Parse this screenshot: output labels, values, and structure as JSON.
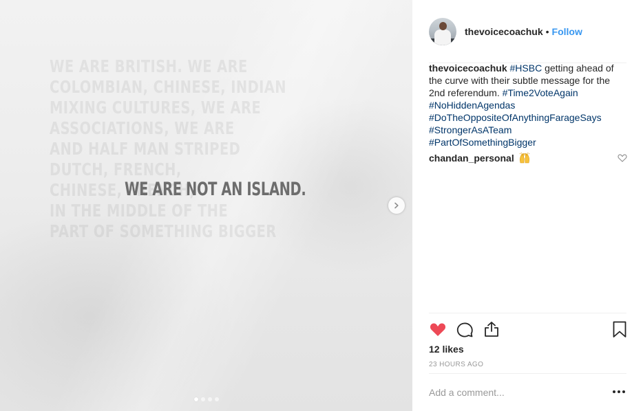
{
  "post_image": {
    "headline": "WE ARE NOT AN ISLAND.",
    "ghost_lines": [
      "WE ARE BRITISH. WE ARE",
      "COLOMBIAN, CHINESE, INDIAN",
      "MIXING CULTURES, WE ARE",
      "ASSOCIATIONS, WE ARE",
      "AND HALF MAN STRIPED",
      "DUTCH, FRENCH,",
      "CHINESE, FRENCH,",
      "IN THE MIDDLE OF THE",
      "PART OF SOMETHING BIGGER"
    ],
    "carousel": {
      "count": 4,
      "active_index": 0
    },
    "icons": {
      "next": "chevron-right-icon"
    }
  },
  "header": {
    "username": "thevoicecoachuk",
    "separator": "•",
    "follow_label": "Follow",
    "follow_color": "#3897f0"
  },
  "caption": {
    "username": "thevoicecoachuk",
    "hashtag_hsbc": "#HSBC",
    "text": " getting ahead of the curve with their subtle message for the 2nd referendum. ",
    "hashtags": [
      "#Time2VoteAgain",
      "#NoHiddenAgendas",
      "#DoTheOppositeOfAnythingFarageSays",
      "#StrongerAsATeam",
      "#PartOfSomethingBigger"
    ],
    "hashtag_color": "#003569"
  },
  "comments": [
    {
      "username": "chandan_personal",
      "emoji": "raised-hands-emoji"
    }
  ],
  "actions": {
    "like_icon": "heart-filled-icon",
    "like_color": "#ed4956",
    "comment_icon": "speech-bubble-icon",
    "share_icon": "share-icon",
    "save_icon": "bookmark-icon"
  },
  "likes_text": "12 likes",
  "time_ago": "23 HOURS AGO",
  "add_comment": {
    "placeholder": "Add a comment...",
    "more_icon": "more-options-icon"
  }
}
